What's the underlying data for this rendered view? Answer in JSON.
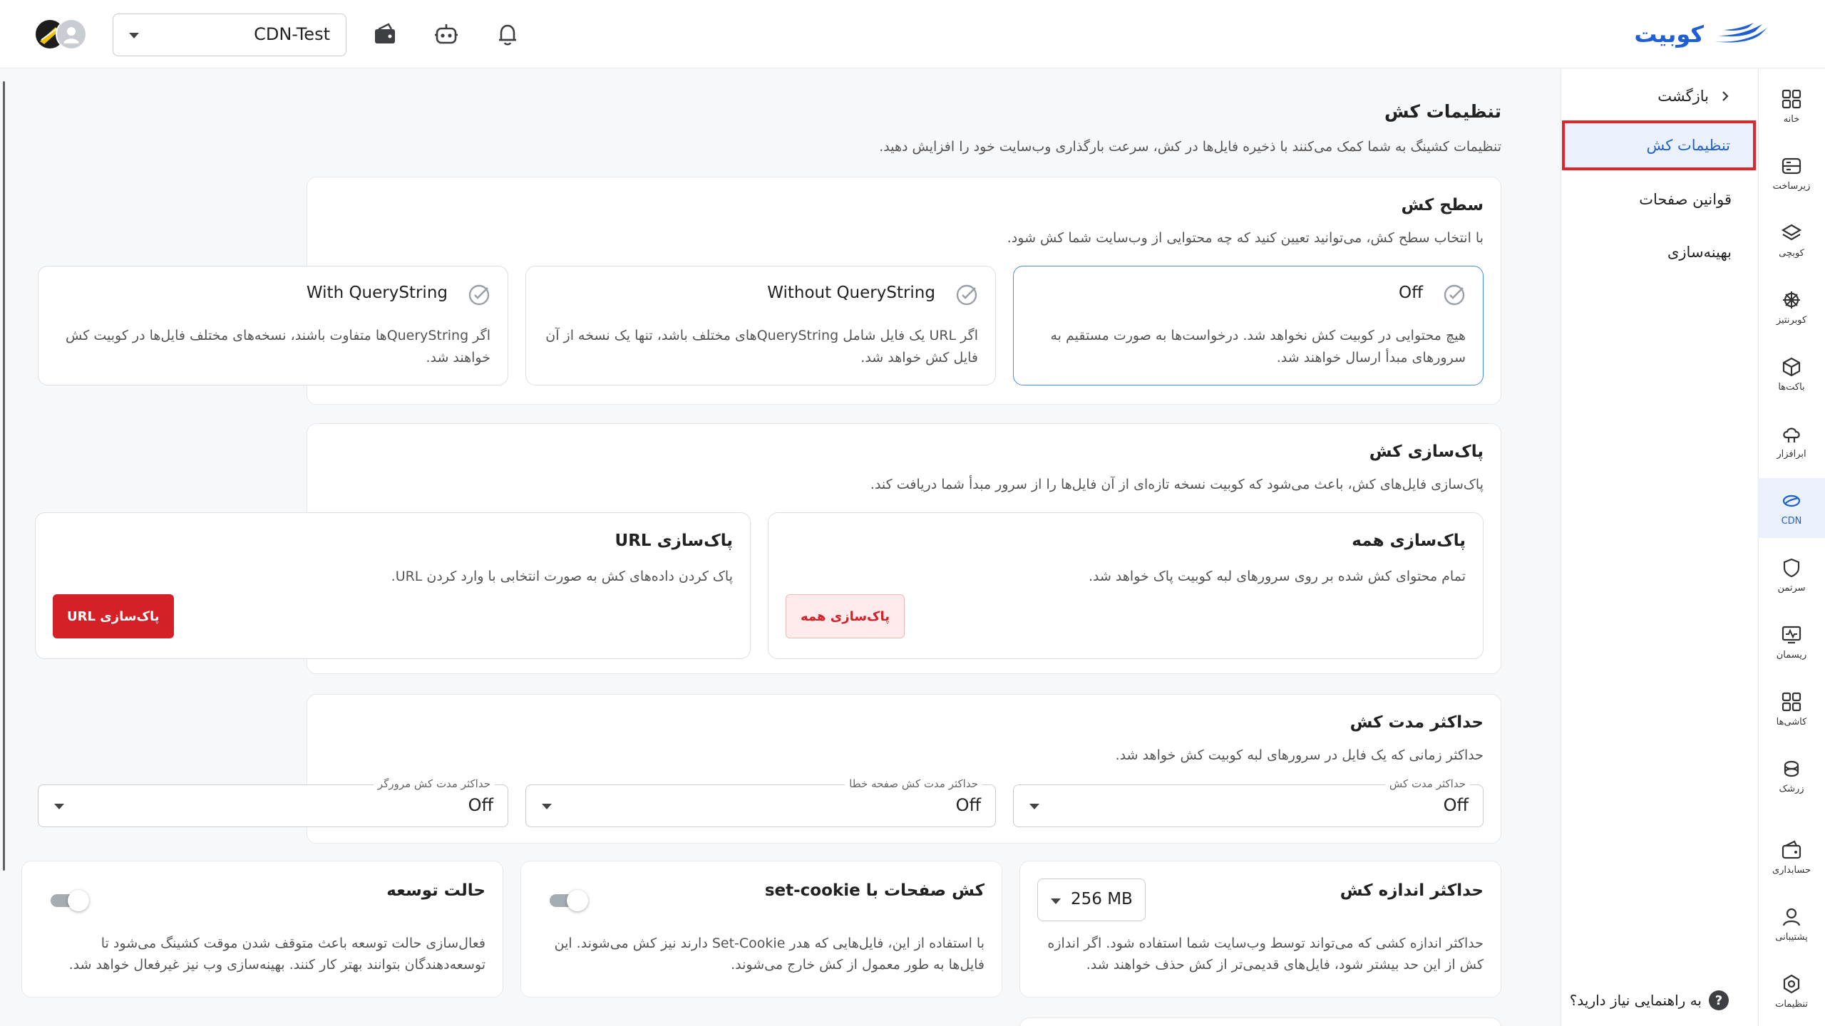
{
  "header": {
    "logo_text": "کوبیت",
    "project": "CDN-Test"
  },
  "rail": {
    "items": [
      {
        "label": "خانه",
        "icon": "grid-icon"
      },
      {
        "label": "زیرساخت",
        "icon": "server-icon"
      },
      {
        "label": "کوبچی",
        "icon": "layers-icon"
      },
      {
        "label": "کوبرنتیز",
        "icon": "kubernetes-icon"
      },
      {
        "label": "باکت‌ها",
        "icon": "cube-icon"
      },
      {
        "label": "ابرافزار",
        "icon": "cloud-app-icon"
      },
      {
        "label": "CDN",
        "icon": "cdn-icon"
      },
      {
        "label": "سرتمن",
        "icon": "shield-icon"
      },
      {
        "label": "ریسمان",
        "icon": "monitor-icon"
      },
      {
        "label": "کاشی‌ها",
        "icon": "tiles-icon"
      },
      {
        "label": "زرشک",
        "icon": "zereshk-icon"
      },
      {
        "label": "حسابداری",
        "icon": "wallet-icon"
      },
      {
        "label": "پشتیبانی",
        "icon": "support-icon"
      },
      {
        "label": "تنظیمات",
        "icon": "gear-icon"
      }
    ]
  },
  "subnav": {
    "back_label": "بازگشت",
    "items": [
      "تنظیمات کش",
      "قوانین صفحات",
      "بهینه‌سازی"
    ],
    "help": "به راهنمایی نیاز دارید؟"
  },
  "page": {
    "title": "تنظیمات کش",
    "description": "تنظیمات کشینگ به شما کمک می‌کنند با ذخیره فایل‌ها در کش، سرعت بارگذاری وب‌سایت خود را افزایش دهید."
  },
  "cache_level": {
    "title": "سطح کش",
    "description": "با انتخاب سطح کش، می‌توانید تعیین کنید که چه محتوایی از وب‌سایت شما کش شود.",
    "options": [
      {
        "title": "Off",
        "description": "هیچ محتوایی در کوبیت کش نخواهد شد. درخواست‌ها به صورت مستقیم به سرورهای مبدأ ارسال خواهند شد."
      },
      {
        "title": "Without QueryString",
        "description": "اگر URL یک فایل شامل QueryStringهای مختلف باشد، تنها یک نسخه از آن فایل کش خواهد شد."
      },
      {
        "title": "With QueryString",
        "description": "اگر QueryStringها متفاوت باشند، نسخه‌های مختلف فایل‌ها در کوبیت کش خواهند شد."
      }
    ]
  },
  "purge": {
    "title": "پاک‌سازی کش",
    "description": "پاک‌سازی فایل‌های کش، باعث می‌شود که کوبیت نسخه تازه‌ای از آن فایل‌ها را از سرور مبدأ شما دریافت کند.",
    "all": {
      "title": "پاک‌سازی همه",
      "description": "تمام محتوای کش شده بر روی سرورهای لبه کوبیت پاک خواهد شد.",
      "button": "پاک‌سازی همه"
    },
    "url": {
      "title": "پاک‌سازی URL",
      "description": "پاک کردن داده‌های کش به صورت انتخابی با وارد کردن URL.",
      "button": "پاک‌سازی URL"
    }
  },
  "ttl": {
    "title": "حداکثر مدت کش",
    "description": "حداکثر زمانی که یک فایل در سرورهای لبه کوبیت کش خواهد شد.",
    "fields": [
      {
        "label": "حداکثر مدت کش",
        "value": "Off"
      },
      {
        "label": "حداکثر مدت کش صفحه خطا",
        "value": "Off"
      },
      {
        "label": "حداکثر مدت کش مرورگر",
        "value": "Off"
      }
    ]
  },
  "max_size": {
    "title": "حداکثر اندازه کش",
    "value": "256 MB",
    "description": "حداکثر اندازه کشی که می‌تواند توسط وب‌سایت شما استفاده شود. اگر اندازه کش از این حد بیشتر شود، فایل‌های قدیمی‌تر از کش حذف خواهند شد."
  },
  "set_cookie": {
    "title": "کش صفحات با set-cookie",
    "description": "با استفاده از این، فایل‌هایی که هدر Set-Cookie دارند نیز کش می‌شوند. این فایل‌ها به طور معمول از کش خارج می‌شوند.",
    "enabled": false
  },
  "dev_mode": {
    "title": "حالت توسعه",
    "description": "فعال‌سازی حالت توسعه باعث متوقف شدن موقت کشینگ می‌شود تا توسعه‌دهندگان بتوانند بهتر کار کنند. بهینه‌سازی وب نیز غیرفعال خواهد شد.",
    "enabled": false
  },
  "colors": {
    "accent": "#1f5fd6",
    "danger": "#d52027",
    "highlight": "#e0262b"
  }
}
